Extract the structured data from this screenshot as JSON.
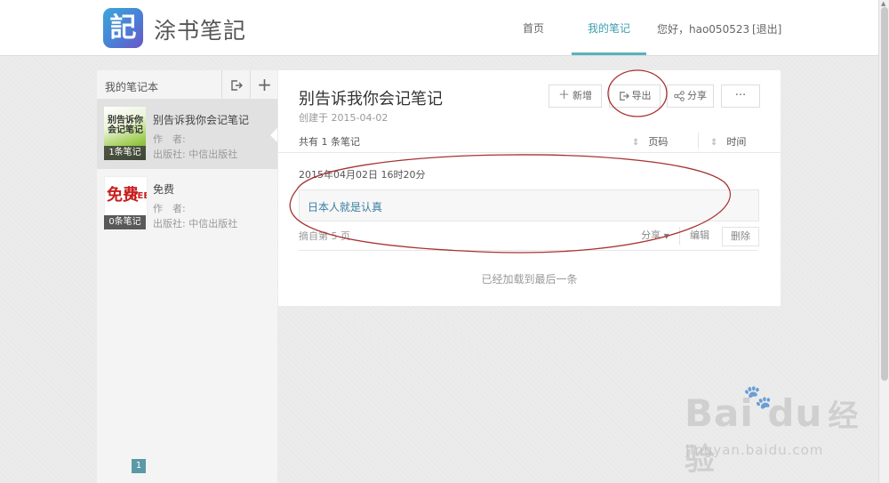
{
  "header": {
    "logo_glyph": "記",
    "logo_text": "涂书笔記",
    "nav": [
      {
        "label": "首页",
        "active": false
      },
      {
        "label": "我的笔记",
        "active": true
      }
    ],
    "greeting": "您好，hao050523",
    "logout": "[退出]",
    "accent": "#58b2bf"
  },
  "sidebar": {
    "title": "我的笔记本",
    "export_icon": "export-icon",
    "add_icon": "plus-icon",
    "books": [
      {
        "name": "别告诉我你会记笔记",
        "author": "作　者:",
        "publisher": "出版社: 中信出版社",
        "badge": "1条笔记",
        "cover_text": "别告诉你会记笔记",
        "active": true
      },
      {
        "name": "免费",
        "author": "作　者:",
        "publisher": "出版社: 中信出版社",
        "badge": "0条笔记",
        "cover_text_a": "免费",
        "cover_text_b": "FREE",
        "active": false
      }
    ],
    "pager": "1"
  },
  "main": {
    "title": "别告诉我你会记笔记",
    "created": "创建于 2015-04-02",
    "toolbar": {
      "new_label": "新增",
      "export_label": "导出",
      "share_label": "分享",
      "more_label": "···"
    },
    "count_text": "共有 1 条笔记",
    "sort_page_label": "页码",
    "sort_time_label": "时间",
    "notes": [
      {
        "date": "2015年04月02日 16时20分",
        "content": "日本人就是认真",
        "page": "摘自第 5 页",
        "share": "分享",
        "edit": "编辑",
        "delete": "删除"
      }
    ],
    "loaded_text": "已经加载到最后一条"
  },
  "watermark": {
    "brand": "Bai  du",
    "brand_cn": "经验",
    "url": "jingyan.baidu.com"
  }
}
